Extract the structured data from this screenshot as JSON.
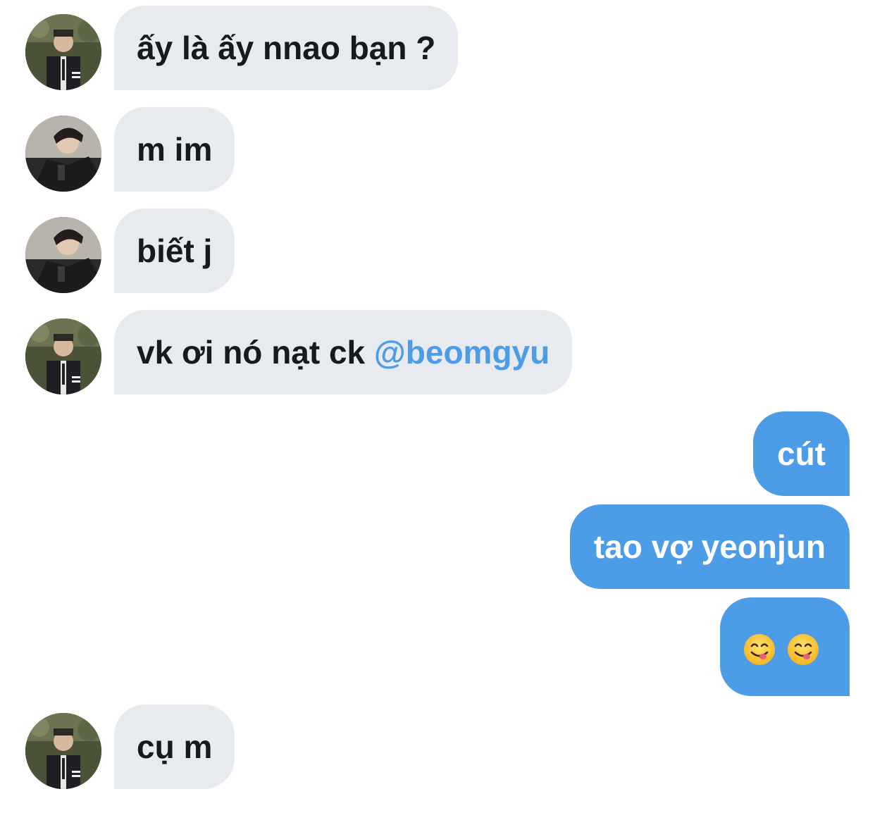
{
  "messages": [
    {
      "sender": "other",
      "avatar": "avatar-suit",
      "text": "ấy là ấy nnao bạn ?"
    },
    {
      "sender": "other",
      "avatar": "avatar-jacket",
      "text": "m im"
    },
    {
      "sender": "other",
      "avatar": "avatar-jacket",
      "text": "biết j"
    },
    {
      "sender": "other",
      "avatar": "avatar-suit",
      "text": "vk ơi nó nạt ck ",
      "mention": "@beomgyu"
    },
    {
      "sender": "self",
      "text": "cút"
    },
    {
      "sender": "self",
      "text": "tao vợ yeonjun"
    },
    {
      "sender": "self",
      "emoji": [
        "yum-face-emoji",
        "yum-face-emoji"
      ]
    },
    {
      "sender": "other",
      "avatar": "avatar-suit",
      "text": "cụ m"
    }
  ],
  "colors": {
    "incoming_bubble": "#e7eaee",
    "outgoing_bubble": "#4d9ce8",
    "mention": "#4d9ce8",
    "incoming_text": "#151a1f",
    "outgoing_text": "#ffffff"
  }
}
